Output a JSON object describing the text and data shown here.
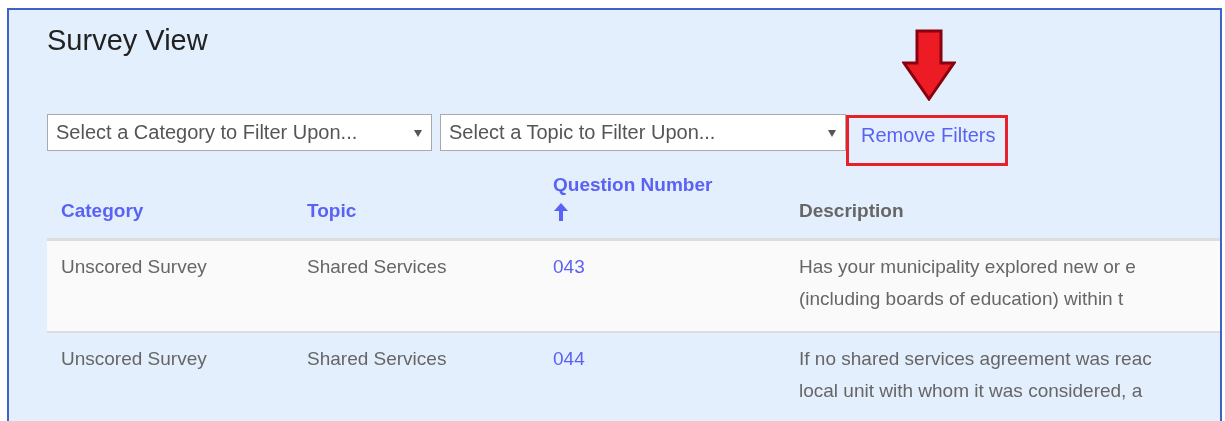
{
  "title": "Survey View",
  "filters": [
    {
      "placeholder": "Select a Category to Filter Upon..."
    },
    {
      "placeholder": "Select a Topic to Filter Upon..."
    }
  ],
  "remove_filters": {
    "label": "Remove Filters",
    "highlighted": true
  },
  "table": {
    "columns": [
      {
        "label": "Category",
        "sortable": true,
        "sorted": false
      },
      {
        "label": "Topic",
        "sortable": true,
        "sorted": false
      },
      {
        "label": "Question Number",
        "sortable": true,
        "sorted": true
      },
      {
        "label": "Description",
        "sortable": false,
        "sorted": false
      }
    ],
    "rows": [
      {
        "category": "Unscored Survey",
        "topic": "Shared Services",
        "question_number": "043",
        "description": [
          "Has your municipality explored new or e",
          "(including boards of education) within t"
        ]
      },
      {
        "category": "Unscored Survey",
        "topic": "Shared Services",
        "question_number": "044",
        "description": [
          "If no shared services agreement was reac",
          "local unit with whom it was considered, a"
        ]
      }
    ]
  }
}
